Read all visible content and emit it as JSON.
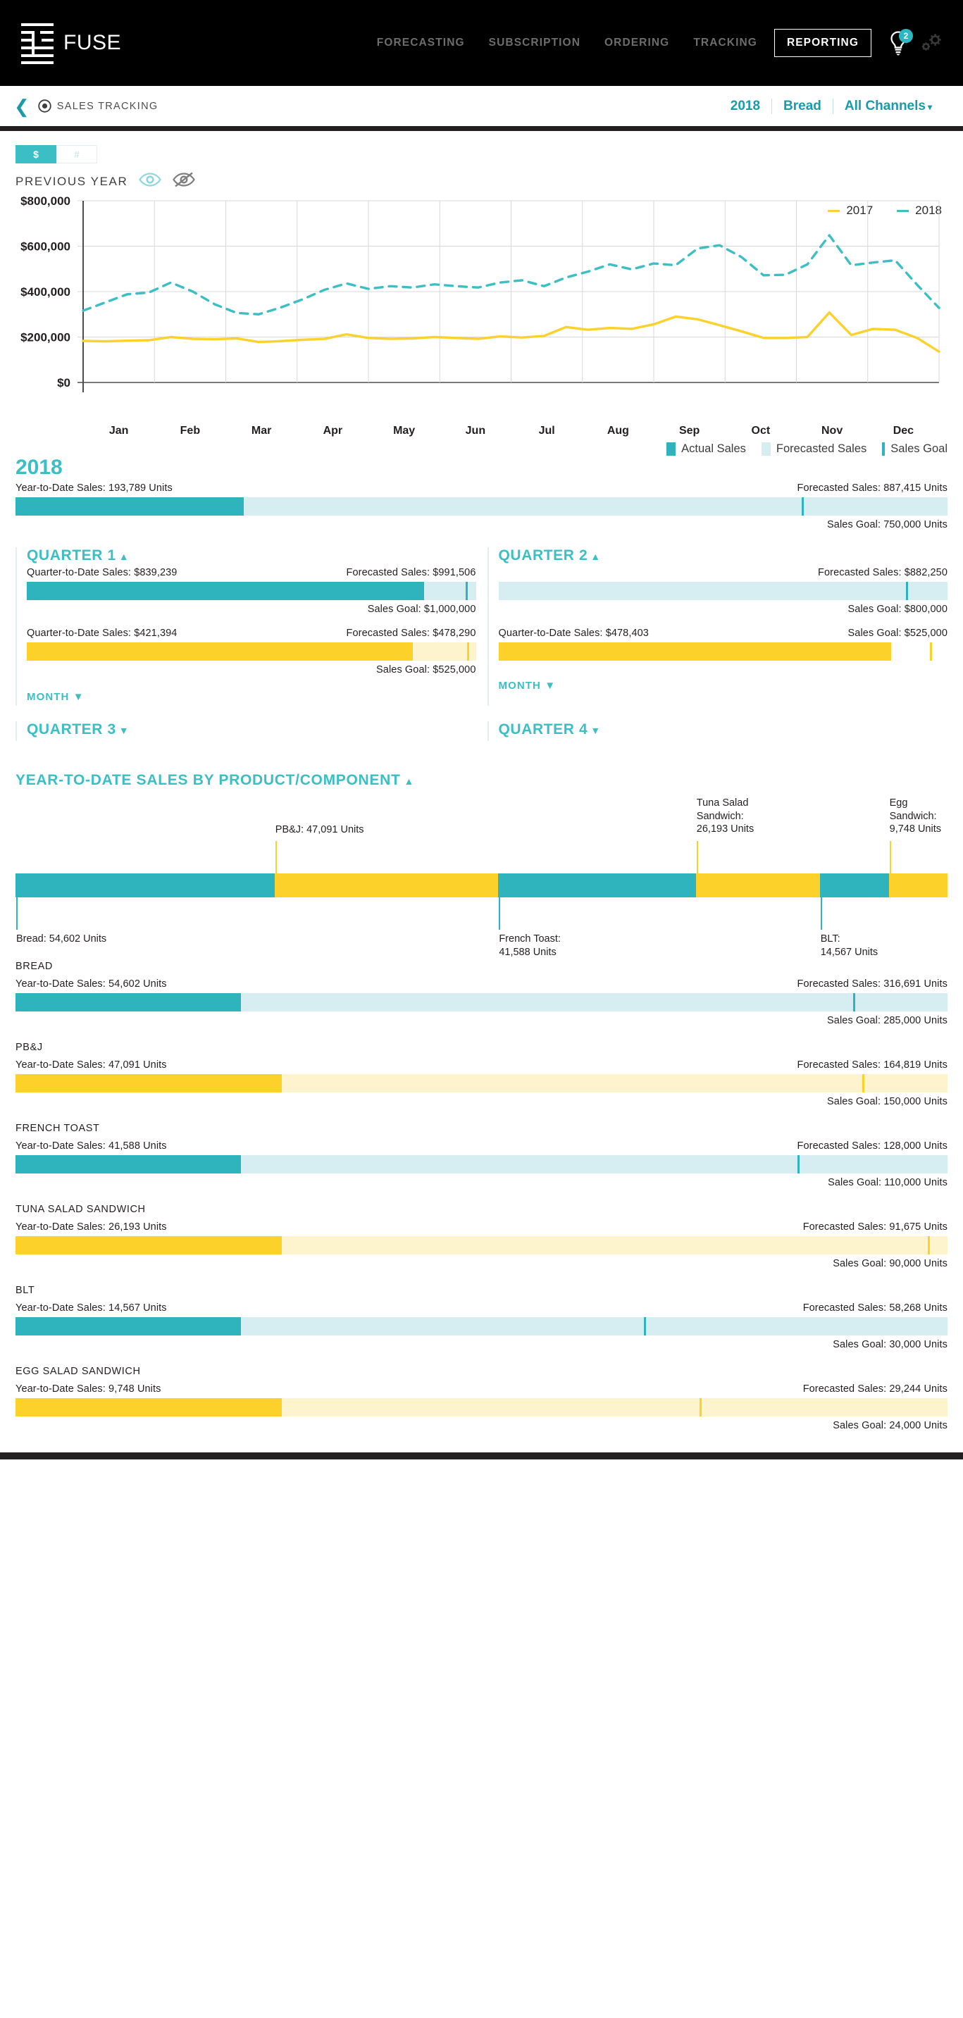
{
  "brand": {
    "name": "FUSE",
    "logo_icon": "fuse-logo-icon"
  },
  "nav": {
    "links": [
      {
        "label": "FORECASTING",
        "active": false
      },
      {
        "label": "SUBSCRIPTION",
        "active": false
      },
      {
        "label": "ORDERING",
        "active": false
      },
      {
        "label": "TRACKING",
        "active": false
      },
      {
        "label": "REPORTING",
        "active": true
      }
    ],
    "notifications_badge": "2",
    "bulb_icon": "lightbulb-icon",
    "settings_icon": "gears-icon"
  },
  "breadcrumb": {
    "back_icon": "back-chevron-icon",
    "page_icon": "target-icon",
    "title": "SALES TRACKING",
    "filters": [
      {
        "label": "2018",
        "has_caret": false
      },
      {
        "label": "Bread",
        "has_caret": false
      },
      {
        "label": "All Channels",
        "has_caret": true
      }
    ],
    "caret": "▾"
  },
  "controls": {
    "unit_toggle": {
      "currency": "$",
      "units": "#",
      "selected": "$"
    },
    "previous_year_label": "PREVIOUS YEAR",
    "eye_show_icon": "eye-icon",
    "eye_hide_icon": "eye-off-icon",
    "previous_year_visible": true
  },
  "colors": {
    "teal": "#2fb4bd",
    "teal_light": "#d6eef1",
    "yellow": "#fcd12a",
    "yellow_light": "#fdf4cd",
    "accent": "#3bbfc4",
    "dark": "#231f20",
    "line_2017": "#fcd12a",
    "line_2018": "#3bbfc4"
  },
  "chart_data": {
    "type": "line",
    "title": "",
    "xlabel": "",
    "ylabel": "",
    "ylim": [
      0,
      800000
    ],
    "yticks": [
      "$0",
      "$200,000",
      "$400,000",
      "$600,000",
      "$800,000"
    ],
    "ytick_values": [
      0,
      200000,
      400000,
      600000,
      800000
    ],
    "grid": true,
    "legend_position": "top-right",
    "categories": [
      "Jan",
      "Feb",
      "Mar",
      "Apr",
      "May",
      "Jun",
      "Jul",
      "Aug",
      "Sep",
      "Oct",
      "Nov",
      "Dec"
    ],
    "series": [
      {
        "name": "2017",
        "color": "#fcd12a",
        "style": "solid",
        "values": [
          183000,
          181000,
          184000,
          186000,
          200000,
          192000,
          190000,
          194000,
          178000,
          182000,
          188000,
          192000,
          212000,
          196000,
          192000,
          194000,
          200000,
          196000,
          192000,
          203000,
          198000,
          205000,
          244000,
          232000,
          240000,
          236000,
          256000,
          290000,
          278000,
          252000,
          225000,
          196000,
          196000,
          200000,
          308000,
          209000,
          236000,
          232000,
          196000,
          136000
        ]
      },
      {
        "name": "2018",
        "color": "#3bbfc4",
        "style": "dashed",
        "values": [
          316000,
          352000,
          388000,
          396000,
          440000,
          400000,
          344000,
          306000,
          300000,
          330000,
          366000,
          408000,
          436000,
          412000,
          424000,
          418000,
          432000,
          424000,
          418000,
          440000,
          450000,
          424000,
          462000,
          488000,
          520000,
          498000,
          524000,
          516000,
          590000,
          604000,
          552000,
          472000,
          474000,
          520000,
          648000,
          516000,
          528000,
          538000,
          430000,
          328000
        ]
      }
    ]
  },
  "year_section": {
    "title": "2018",
    "legend": [
      {
        "label": "Actual Sales",
        "type": "fill",
        "color": "#2fb4bd"
      },
      {
        "label": "Forecasted Sales",
        "type": "fill",
        "color": "#d6eef1"
      },
      {
        "label": "Sales Goal",
        "type": "marker",
        "color": "#2fb4bd"
      }
    ],
    "bar": {
      "actual_label": "Year-to-Date Sales: 193,789 Units",
      "forecast_label": "Forecasted Sales: 887,415 Units",
      "goal_label": "Sales Goal: 750,000 Units",
      "actual_pct": 24.5,
      "goal_pct": 84.5,
      "style": "teal"
    }
  },
  "quarters": [
    {
      "title": "QUARTER 1",
      "expanded": true,
      "toggle_icon": "▲",
      "month_label": "MONTH",
      "month_icon": "▼",
      "bars": [
        {
          "style": "teal",
          "actual_label": "Quarter-to-Date Sales: $839,239",
          "forecast_label": "Forecasted Sales: $991,506",
          "goal_label": "Sales Goal: $1,000,000",
          "actual_pct": 88.5,
          "goal_pct": 98.0
        },
        {
          "style": "yellow",
          "actual_label": "Quarter-to-Date Sales: $421,394",
          "forecast_label": "Forecasted Sales: $478,290",
          "goal_label": "Sales Goal: $525,000",
          "actual_pct": 86.0,
          "goal_pct": 98.3
        }
      ]
    },
    {
      "title": "QUARTER 2",
      "expanded": true,
      "toggle_icon": "▲",
      "month_label": "MONTH",
      "month_icon": "▼",
      "bars": [
        {
          "style": "teal",
          "actual_label": "",
          "forecast_label": "Forecasted Sales: $882,250",
          "goal_label": "Sales Goal: $800,000",
          "actual_pct": 0,
          "goal_pct": 91.0
        },
        {
          "style": "yellow",
          "actual_label": "Quarter-to-Date Sales: $478,403",
          "forecast_label": "Sales Goal: $525,000",
          "goal_label": "",
          "actual_pct": 87.5,
          "goal_pct": 96.3
        }
      ]
    },
    {
      "title": "QUARTER 3",
      "expanded": false,
      "toggle_icon": "▼"
    },
    {
      "title": "QUARTER 4",
      "expanded": false,
      "toggle_icon": "▼"
    }
  ],
  "product_section": {
    "title": "YEAR-TO-DATE SALES BY PRODUCT/COMPONENT",
    "toggle_icon": "▲",
    "stack": [
      {
        "name": "Bread",
        "label": "Bread: 54,602 Units",
        "units": 54602,
        "pct": 27.8,
        "color": "teal",
        "side": "below"
      },
      {
        "name": "PB&J",
        "label": "PB&J: 47,091 Units",
        "units": 47091,
        "pct": 24.0,
        "color": "yellow",
        "side": "above"
      },
      {
        "name": "French Toast",
        "label": "French Toast:\n41,588 Units",
        "units": 41588,
        "pct": 21.2,
        "color": "teal",
        "side": "below"
      },
      {
        "name": "Tuna Salad Sandwich",
        "label": "Tuna Salad\nSandwich:\n26,193 Units",
        "units": 26193,
        "pct": 13.3,
        "color": "yellow",
        "side": "above"
      },
      {
        "name": "BLT",
        "label": "BLT:\n14,567 Units",
        "units": 14567,
        "pct": 7.4,
        "color": "teal",
        "side": "below"
      },
      {
        "name": "Egg Sandwich",
        "label": "Egg\nSandwich:\n9,748 Units",
        "units": 9748,
        "pct": 6.3,
        "color": "yellow",
        "side": "above"
      }
    ],
    "rows": [
      {
        "name": "BREAD",
        "style": "teal",
        "actual_label": "Year-to-Date Sales: 54,602 Units",
        "forecast_label": "Forecasted Sales: 316,691 Units",
        "goal_label": "Sales Goal: 285,000 Units",
        "actual_pct": 24.2,
        "goal_pct": 90.0
      },
      {
        "name": "PB&J",
        "style": "yellow",
        "actual_label": "Year-to-Date Sales: 47,091 Units",
        "forecast_label": "Forecasted Sales: 164,819 Units",
        "goal_label": "Sales Goal: 150,000 Units",
        "actual_pct": 28.6,
        "goal_pct": 91.0
      },
      {
        "name": "FRENCH TOAST",
        "style": "teal",
        "actual_label": "Year-to-Date Sales: 41,588 Units",
        "forecast_label": "Forecasted Sales: 128,000 Units",
        "goal_label": "Sales Goal: 110,000 Units",
        "actual_pct": 24.2,
        "goal_pct": 84.0
      },
      {
        "name": "TUNA SALAD SANDWICH",
        "style": "yellow",
        "actual_label": "Year-to-Date Sales: 26,193 Units",
        "forecast_label": "Forecasted Sales: 91,675 Units",
        "goal_label": "Sales Goal: 90,000 Units",
        "actual_pct": 28.6,
        "goal_pct": 98.0
      },
      {
        "name": "BLT",
        "style": "teal",
        "actual_label": "Year-to-Date Sales: 14,567 Units",
        "forecast_label": "Forecasted Sales: 58,268 Units",
        "goal_label": "Sales Goal: 30,000 Units",
        "actual_pct": 24.2,
        "goal_pct": 67.5
      },
      {
        "name": "EGG SALAD SANDWICH",
        "style": "yellow",
        "actual_label": "Year-to-Date Sales: 9,748 Units",
        "forecast_label": "Forecasted Sales: 29,244 Units",
        "goal_label": "Sales Goal: 24,000 Units",
        "actual_pct": 28.6,
        "goal_pct": 73.5
      }
    ]
  }
}
